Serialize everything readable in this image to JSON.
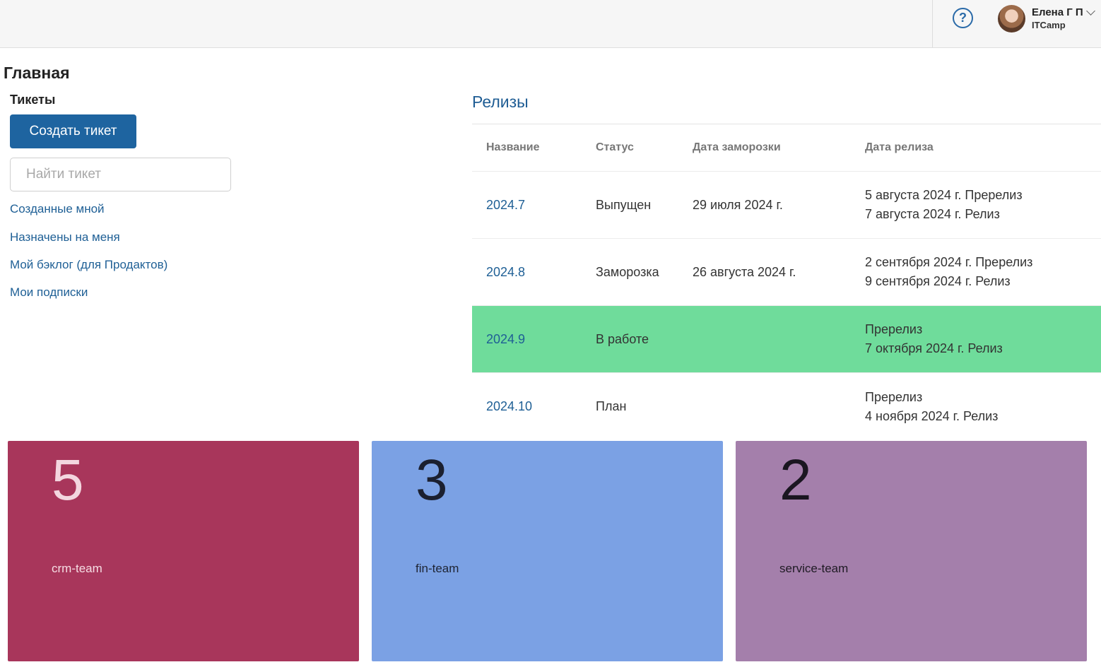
{
  "header": {
    "help_icon": "question-circle-icon",
    "user": {
      "name": "Елена Г П",
      "org": "ITCamp"
    }
  },
  "page": {
    "title": "Главная"
  },
  "tickets": {
    "title": "Тикеты",
    "create_label": "Создать тикет",
    "search_placeholder": "Найти тикет",
    "search_value": "",
    "links": [
      "Созданные мной",
      "Назначены на меня",
      "Мой бэклог (для Продактов)",
      "Мои подписки"
    ]
  },
  "releases": {
    "title": "Релизы",
    "columns": [
      "Название",
      "Статус",
      "Дата заморозки",
      "Дата релиза"
    ],
    "rows": [
      {
        "name": "2024.7",
        "status": "Выпущен",
        "freeze": "29 июля 2024 г.",
        "release_lines": [
          "5 августа 2024 г. Пререлиз",
          "7 августа 2024 г. Релиз"
        ],
        "highlight": false
      },
      {
        "name": "2024.8",
        "status": "Заморозка",
        "freeze": "26 августа 2024 г.",
        "release_lines": [
          "2 сентября 2024 г. Пререлиз",
          "9 сентября 2024 г. Релиз"
        ],
        "highlight": false
      },
      {
        "name": "2024.9",
        "status": "В работе",
        "freeze": "",
        "release_lines": [
          "Пререлиз",
          "7 октября 2024 г. Релиз"
        ],
        "highlight": true
      },
      {
        "name": "2024.10",
        "status": "План",
        "freeze": "",
        "release_lines": [
          "Пререлиз",
          "4 ноября 2024 г. Релиз"
        ],
        "highlight": false
      }
    ],
    "highlight_color": "#6fdc9b"
  },
  "teams": [
    {
      "count": "5",
      "label": "crm-team",
      "bg": "#a8365b",
      "fg": "#f6dde4",
      "count_fg": "#f3d6df"
    },
    {
      "count": "3",
      "label": "fin-team",
      "bg": "#7ba1e4",
      "fg": "#1e2433",
      "count_fg": "#1b2030"
    },
    {
      "count": "2",
      "label": "service-team",
      "bg": "#a47fab",
      "fg": "#1f1a24",
      "count_fg": "#1a1620"
    }
  ]
}
